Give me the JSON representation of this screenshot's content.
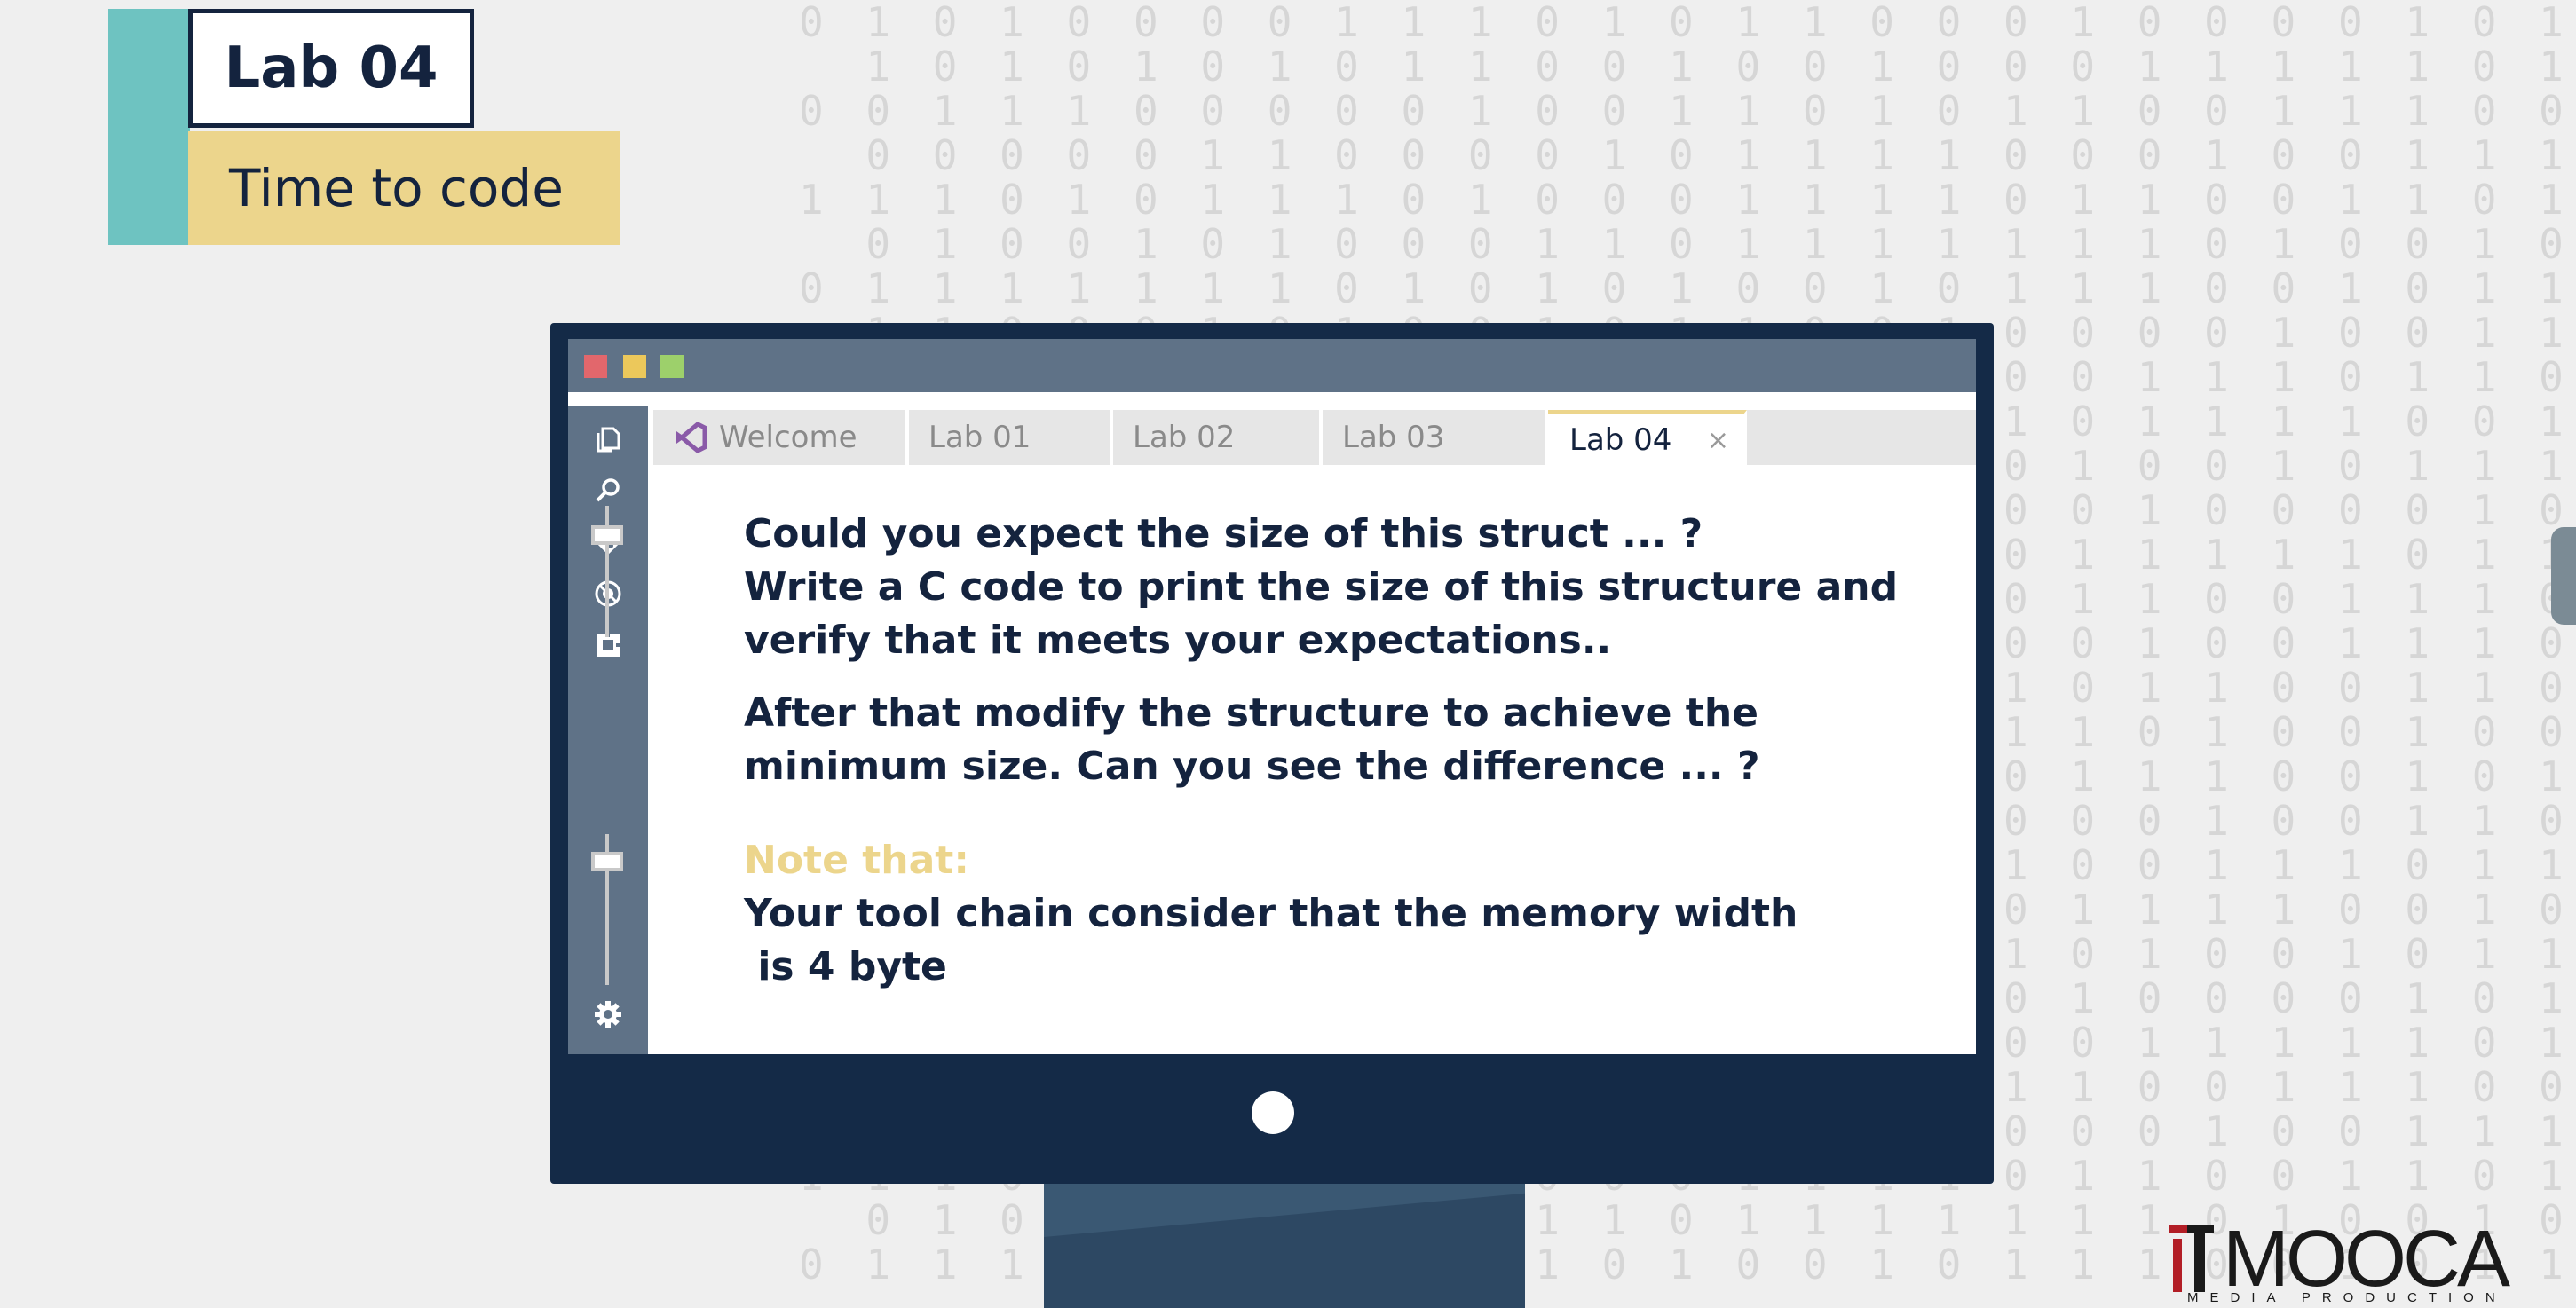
{
  "badge": {
    "title": "Lab 04",
    "subtitle": "Time to code"
  },
  "colors": {
    "navy": "#14233e",
    "teal": "#6ec3c1",
    "yellow": "#ecd58c",
    "slate": "#5f7287"
  },
  "window": {
    "controls": [
      "close",
      "minimize",
      "maximize"
    ],
    "activity_icons": [
      "files-icon",
      "search-icon",
      "git-icon",
      "debug-icon",
      "extensions-icon",
      "gear-icon"
    ],
    "tabs": [
      {
        "label": "Welcome",
        "icon": "visual-studio-icon"
      },
      {
        "label": "Lab 01"
      },
      {
        "label": "Lab 02"
      },
      {
        "label": "Lab 03"
      },
      {
        "label": "Lab 04",
        "active": true,
        "close": "×"
      }
    ]
  },
  "editor": {
    "block1": [
      "Could you expect the size of this struct ... ?",
      "Write a C code to print the size of this structure and",
      "verify that it meets your expectations..",
      "After that modify the structure to achieve the",
      "minimum size. Can you see the difference ... ?"
    ],
    "note_label": "Note that:",
    "block2": [
      "Your tool chain consider that the memory width",
      " is 4 byte"
    ]
  },
  "logo": {
    "name": "MOOCA",
    "tagline": "MEDIA PRODUCTION"
  },
  "background_binary": [
    "0 1 0 1 0 0 0 0 1 1 1 0 1 0 1 1 0 0 0 1 0 0 0 0 1 0 1 0",
    "1 0 1 0 1 0 1 0 1 1 0 0 1 0 0 1 0 0 0 1 1 1 1 1 0 1 1 0",
    "0 0 1 1 1 0 0 0 0 0 1 0 0 1 1 0 1 0 1 1 0 0 1 1 1 0 0 1",
    "0 0 0 0 0 1 1 0 0 0 0 1 0 1 1 1 1 0 0 0 1 0 0 1 1 1 0 0",
    "1 1 1 0 1 0 1 1 1 0 1 0 0 0 1 1 1 1 0 1 1 0 0 1 1 0 1 0",
    "0 1 0 0 1 0 1 0 0 0 1 1 0 1 1 1 1 1 1 1 0 1 0 0 1 0 0 0",
    "0 1 1 1 1 1 1 1 0 1 0 1 0 1 0 0 1 0 1 1 1 0 0 1 0 1 1 1",
    "1 1 0 0 0 1 0 1 0 0 1 0 1 1 0 0 1 0 0 0 0 1 0 0 1 1 0 1",
    "0 0 1 0 1 0 1 0 1 1 1 0 0 0 0 1 1 1 0 0 1 1 1 0 1 1 0 0",
    "1 0 1 1 1 1 1 1 1 0 1 0 0 1 1 1 0 1 0 1 1 1 1 0 0 1 0 1",
    "0 1 0 1 1 0 1 0 0 1 1 1 0 0 1 1 0 1 0 1 0 0 1 0 1 1 1 0"
  ]
}
